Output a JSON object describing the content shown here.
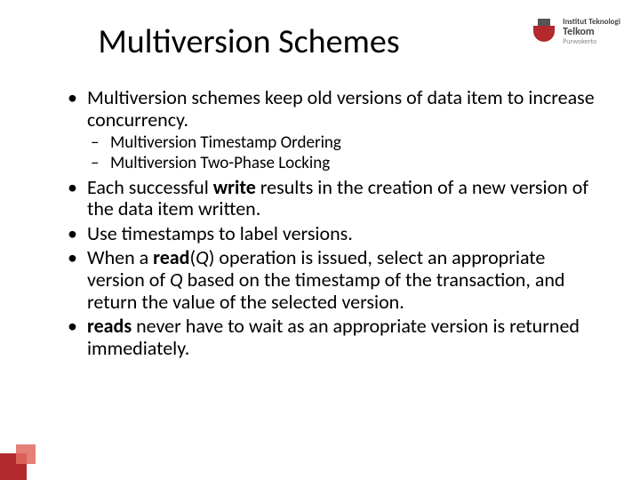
{
  "logo": {
    "line1": "Institut Teknologi",
    "line2": "Telkom",
    "line3": "Purwokerto"
  },
  "title": "Multiversion Schemes",
  "bullets": [
    {
      "segments": [
        {
          "text": "Multiversion schemes keep old versions of data item to increase concurrency."
        }
      ],
      "sub": [
        "Multiversion Timestamp Ordering",
        "Multiversion Two-Phase Locking"
      ]
    },
    {
      "segments": [
        {
          "text": "Each successful "
        },
        {
          "text": "write",
          "bold": true
        },
        {
          "text": " results in the creation of a new version of the data item written."
        }
      ]
    },
    {
      "segments": [
        {
          "text": "Use timestamps to label versions."
        }
      ]
    },
    {
      "segments": [
        {
          "text": "When a "
        },
        {
          "text": "read",
          "bold": true
        },
        {
          "text": "("
        },
        {
          "text": "Q",
          "italic": true
        },
        {
          "text": ") operation is issued, select an appropriate version of "
        },
        {
          "text": "Q",
          "italic": true
        },
        {
          "text": " based on the timestamp of the transaction, and return the value of the selected version."
        }
      ]
    },
    {
      "segments": [
        {
          "text": "reads",
          "bold": true
        },
        {
          "text": " never have to wait as an appropriate version is returned immediately."
        }
      ]
    }
  ]
}
